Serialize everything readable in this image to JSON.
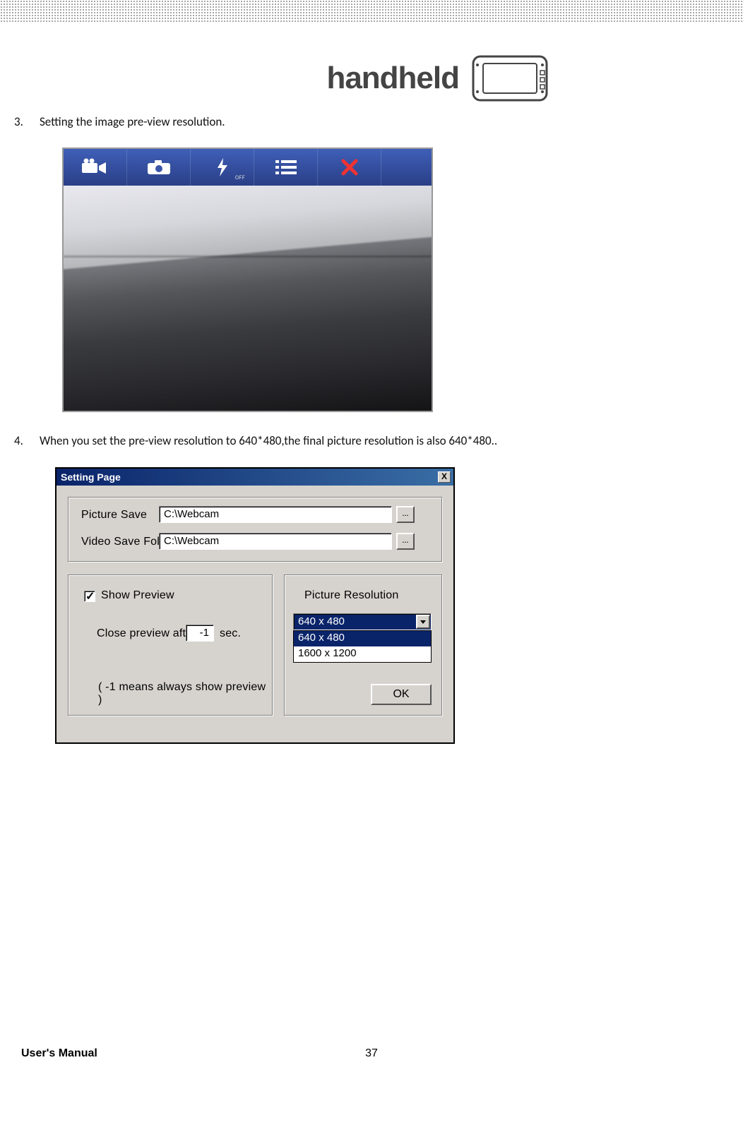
{
  "brand": "handheld",
  "steps": {
    "s3": {
      "num": "3.",
      "text": "Setting the image pre-view resolution."
    },
    "s4": {
      "num": "4.",
      "text": "When you set the pre-view resolution to 640*480,the final picture resolution is also 640*480.."
    }
  },
  "camera_toolbar": {
    "flash_off_label": "OFF"
  },
  "settings": {
    "title": "Setting Page",
    "close_x": "X",
    "picture_save_label": "Picture Save",
    "picture_save_value": "C:\\Webcam",
    "video_save_label": "Video Save Folder",
    "video_save_value": "C:\\Webcam",
    "browse": "...",
    "show_preview_label": "Show Preview",
    "close_after_prefix": "Close preview after",
    "close_after_value": "-1",
    "close_after_suffix": "sec.",
    "hint": "( -1 means always show preview )",
    "picture_resolution_label": "Picture Resolution",
    "resolution_selected": "640 x 480",
    "resolution_options": [
      "640 x 480",
      "1600 x 1200"
    ],
    "ok": "OK"
  },
  "footer": {
    "title": "User's Manual",
    "page": "37"
  }
}
